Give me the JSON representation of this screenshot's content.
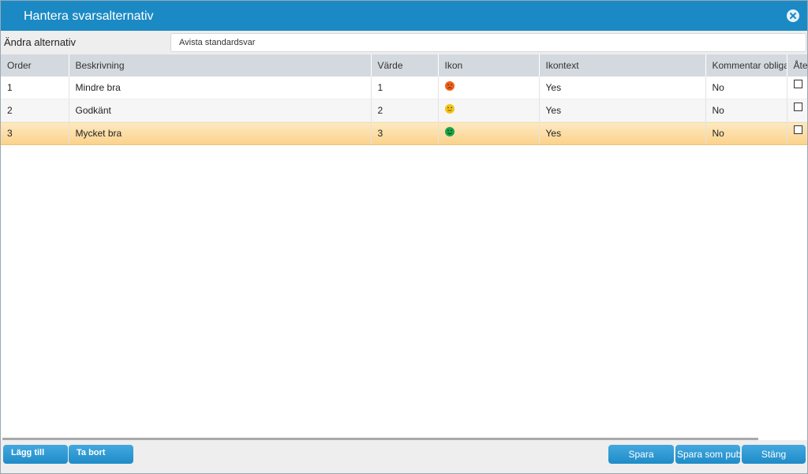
{
  "dialog": {
    "title": "Hantera svarsalternativ"
  },
  "edit": {
    "label": "Ändra alternativ",
    "value": "Avista standardsvar"
  },
  "table": {
    "columns": [
      "Order",
      "Beskrivning",
      "Värde",
      "Ikon",
      "Ikontext",
      "Kommentar obligatorisk",
      "Återkoppling"
    ],
    "rows": [
      {
        "order": "1",
        "description": "Mindre bra",
        "value": "1",
        "icon": "sad-face-icon",
        "icon_color": "#f0601c",
        "icon_text": "Yes",
        "comment": "No",
        "selected": false
      },
      {
        "order": "2",
        "description": "Godkänt",
        "value": "2",
        "icon": "neutral-face-icon",
        "icon_color": "#f2c318",
        "icon_text": "Yes",
        "comment": "No",
        "selected": false
      },
      {
        "order": "3",
        "description": "Mycket bra",
        "value": "3",
        "icon": "happy-face-icon",
        "icon_color": "#1aa34a",
        "icon_text": "Yes",
        "comment": "No",
        "selected": true
      }
    ]
  },
  "footer": {
    "add_label": "Lägg till",
    "remove_label": "Ta bort",
    "save_label": "Spara",
    "save_publish_label": "Spara som publicerad",
    "close_label": "Stäng"
  },
  "colors": {
    "titlebar": "#1b8ac4",
    "button": "#2a96d2",
    "selected_row": "#fbd28a"
  }
}
